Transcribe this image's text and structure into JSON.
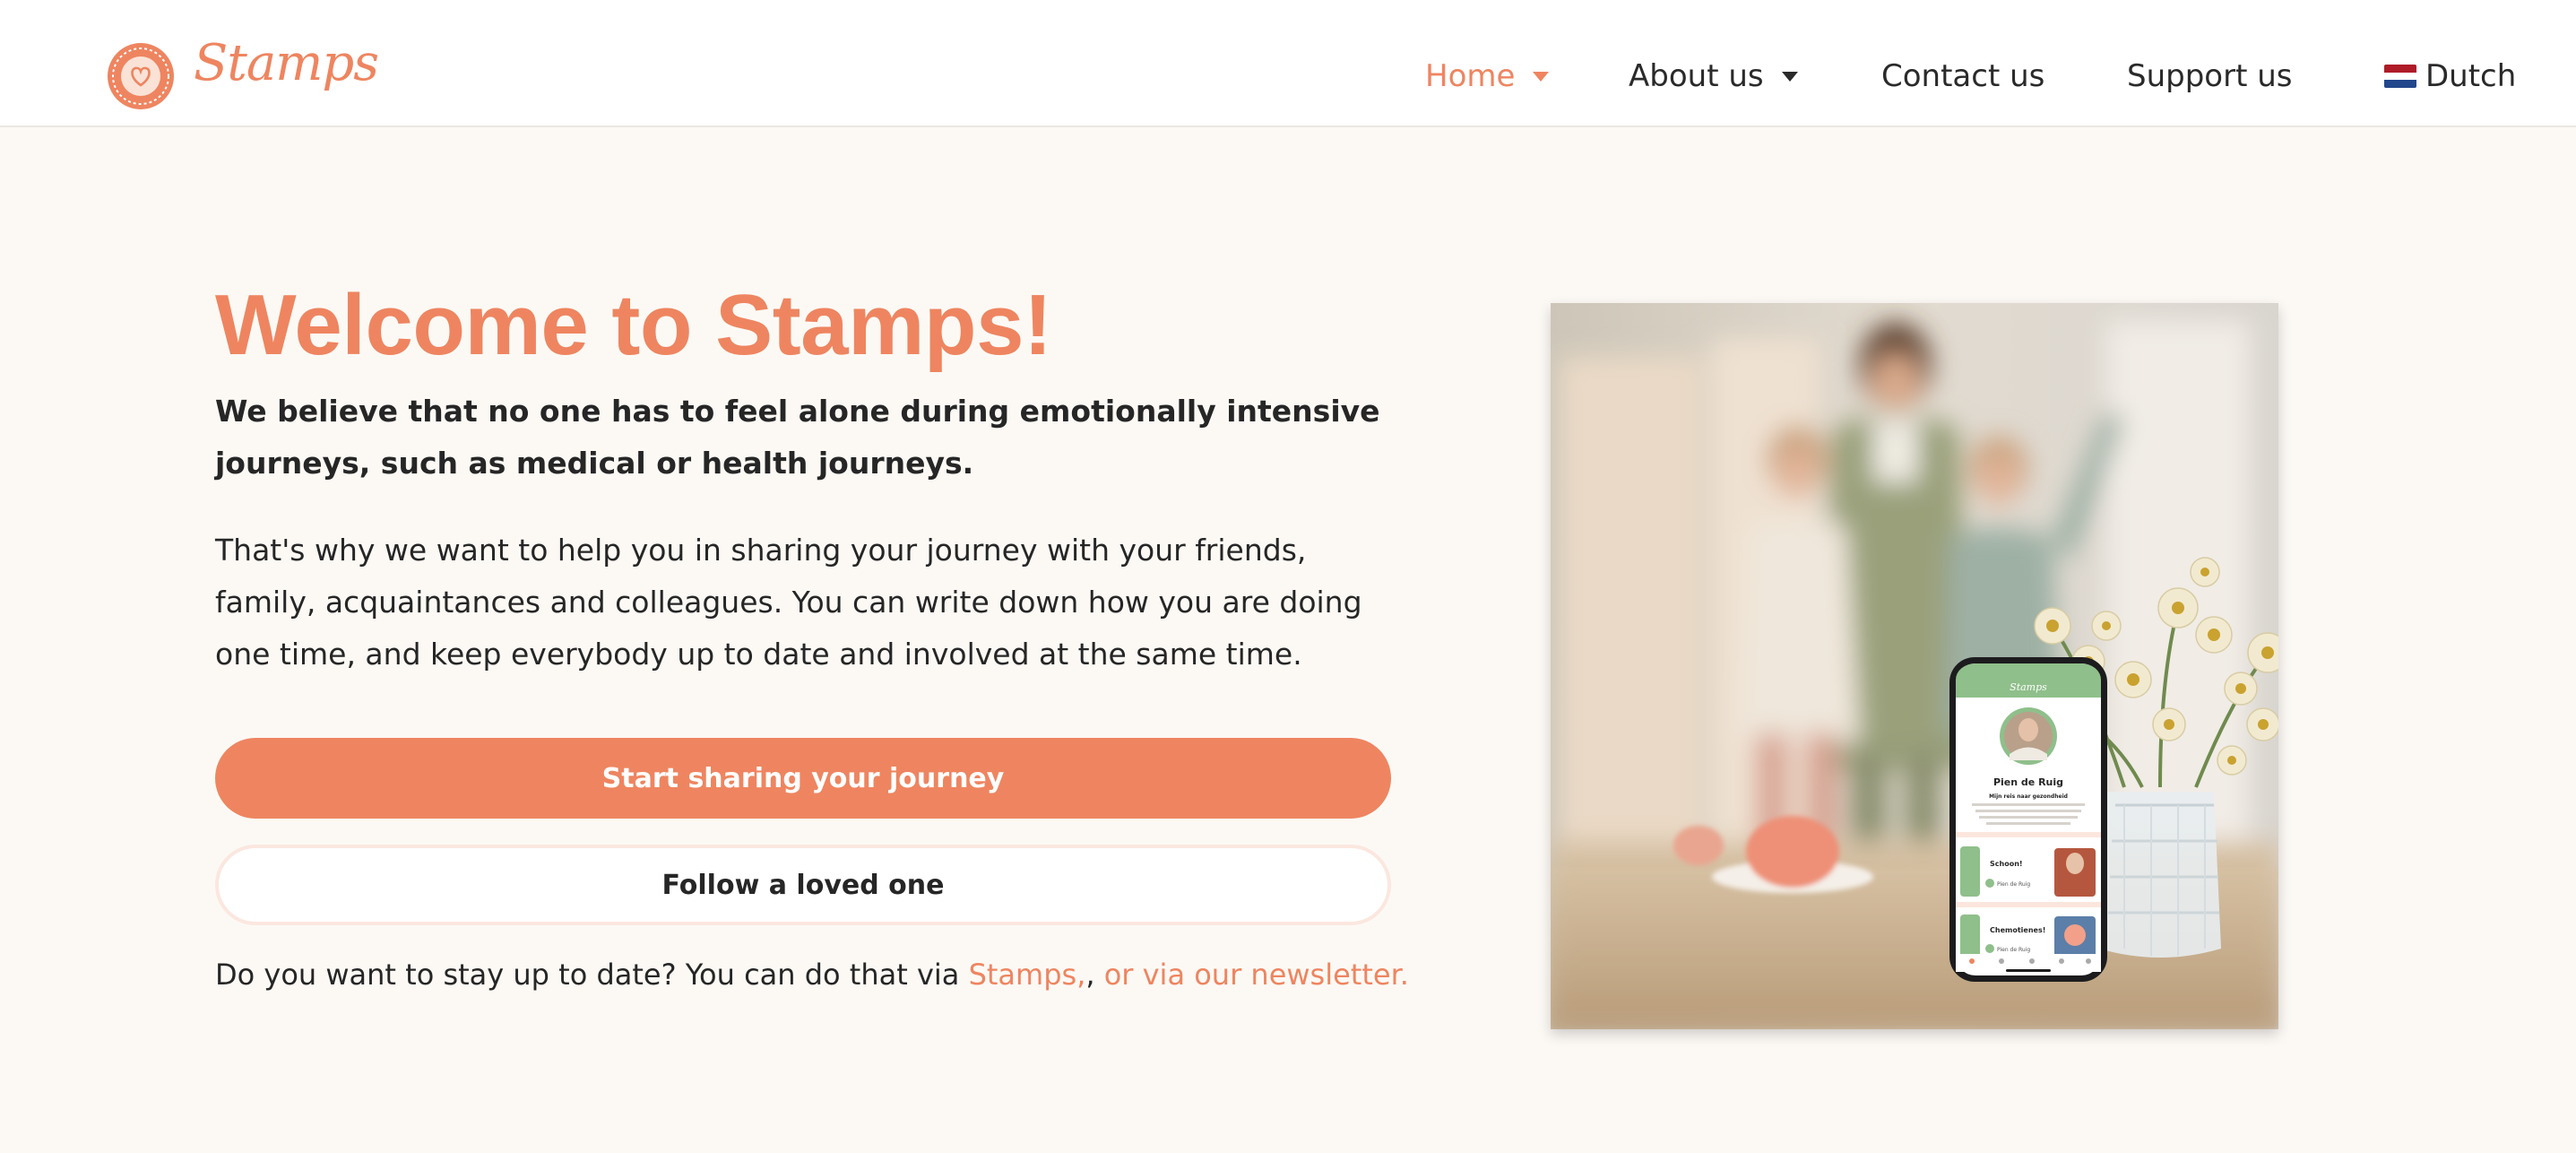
{
  "colors": {
    "accent": "#ee8560",
    "background": "#fcf9f5",
    "text": "#262626"
  },
  "header": {
    "logo_text": "Stamps",
    "nav": {
      "home": "Home",
      "about": "About us",
      "contact": "Contact us",
      "support": "Support us",
      "language": "Dutch"
    }
  },
  "hero": {
    "title": "Welcome to Stamps!",
    "lead": "We believe that no one has to feel alone during emotionally intensive journeys, such as medical or health journeys.",
    "body": "That's why we want to help you in sharing your journey with your friends, family, acquaintances and colleagues. You can write down how you are doing one time, and keep everybody up to date and involved at the same time.",
    "primary_button": "Start sharing your journey",
    "secondary_button": "Follow a loved one",
    "note_prefix": "Do you want to stay up to date? You can do that via ",
    "note_link1": "Stamps,",
    "note_sep": ", ",
    "note_link2": "or via our newsletter."
  },
  "phone": {
    "app_title": "Stamps",
    "profile_name": "Pien de Ruig",
    "profile_subtitle": "Mijn reis naar gezondheid",
    "post1_title": "Schoon!",
    "post2_title": "Chemotienes!",
    "post_author": "Pien de Ruig"
  }
}
